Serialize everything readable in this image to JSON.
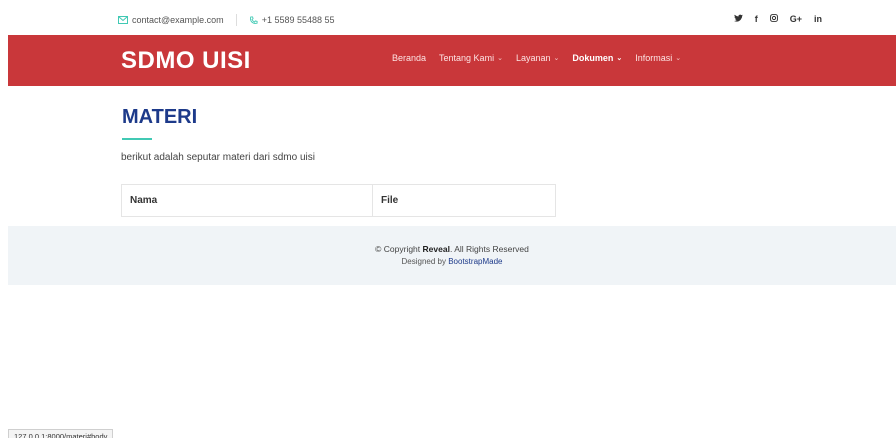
{
  "topbar": {
    "email": "contact@example.com",
    "phone": "+1 5589 55488 55",
    "social": [
      {
        "icon": "twitter-icon",
        "glyph": "🐦"
      },
      {
        "icon": "facebook-icon",
        "glyph": "f"
      },
      {
        "icon": "instagram-icon",
        "glyph": "◎"
      },
      {
        "icon": "google-plus-icon",
        "glyph": "G+"
      },
      {
        "icon": "linkedin-icon",
        "glyph": "in"
      }
    ]
  },
  "header": {
    "logo": "SDMO UISI",
    "brand_color": "#c9373a",
    "nav": [
      {
        "label": "Beranda",
        "dropdown": false,
        "active": false
      },
      {
        "label": "Tentang Kami",
        "dropdown": true,
        "active": false
      },
      {
        "label": "Layanan",
        "dropdown": true,
        "active": false
      },
      {
        "label": "Dokumen",
        "dropdown": true,
        "active": true
      },
      {
        "label": "Informasi",
        "dropdown": true,
        "active": false
      }
    ]
  },
  "main": {
    "title": "MATERI",
    "description": "berikut adalah seputar materi dari sdmo uisi",
    "table_headers": [
      "Nama",
      "File"
    ]
  },
  "footer": {
    "copyright_prefix": "© Copyright",
    "copyright_brand": "Reveal",
    "copyright_suffix": ". All Rights Reserved",
    "designed_by": "Designed by",
    "designed_link": "BootstrapMade"
  },
  "statusbar": {
    "url": "127.0.0.1:8000/materi#body"
  }
}
